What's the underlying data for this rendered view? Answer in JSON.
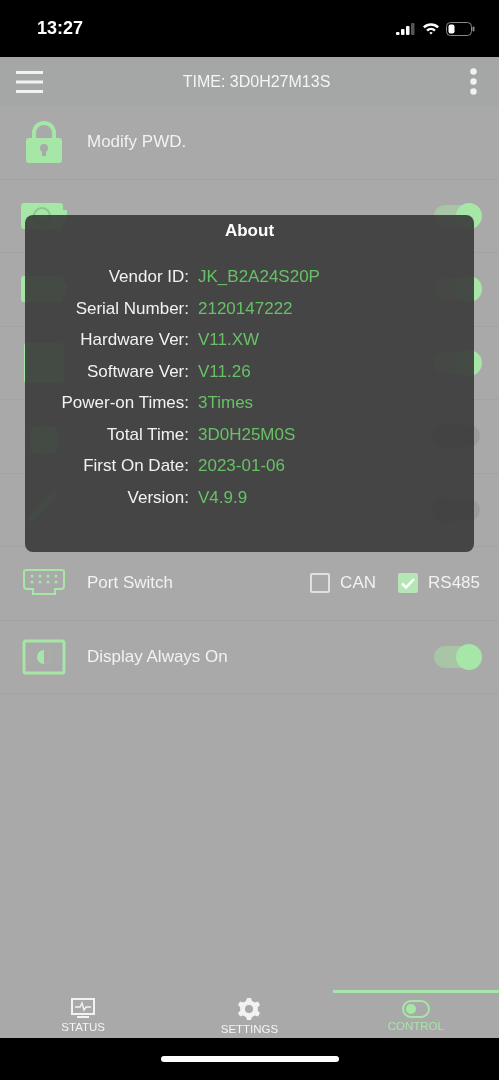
{
  "status_bar": {
    "time": "13:27"
  },
  "header": {
    "title": "TIME: 3D0H27M13S"
  },
  "rows": [
    {
      "kind": "password",
      "label": "Modify PWD."
    },
    {
      "kind": "charge",
      "on": true
    },
    {
      "kind": "discharge",
      "on": true
    },
    {
      "kind": "balance",
      "on": true
    },
    {
      "kind": "emergency",
      "on": false
    },
    {
      "kind": "sensor",
      "on": false
    },
    {
      "kind": "port",
      "label": "Port Switch",
      "options": [
        {
          "label": "CAN",
          "checked": false
        },
        {
          "label": "RS485",
          "checked": true
        }
      ]
    },
    {
      "kind": "display",
      "label": "Display Always On",
      "on": true
    }
  ],
  "dialog": {
    "title": "About",
    "fields": [
      {
        "label": "Vendor ID:",
        "value": "JK_B2A24S20P"
      },
      {
        "label": "Serial Number:",
        "value": "2120147222"
      },
      {
        "label": "Hardware Ver:",
        "value": "V11.XW"
      },
      {
        "label": "Software Ver:",
        "value": "V11.26"
      },
      {
        "label": "Power-on Times:",
        "value": "3Times"
      },
      {
        "label": "Total Time:",
        "value": "3D0H25M0S"
      },
      {
        "label": "First On Date:",
        "value": "2023-01-06"
      },
      {
        "label": "Version:",
        "value": "V4.9.9"
      }
    ]
  },
  "tabs": [
    {
      "label": "STATUS",
      "selected": false
    },
    {
      "label": "SETTINGS",
      "selected": false
    },
    {
      "label": "CONTROL",
      "selected": true
    }
  ]
}
